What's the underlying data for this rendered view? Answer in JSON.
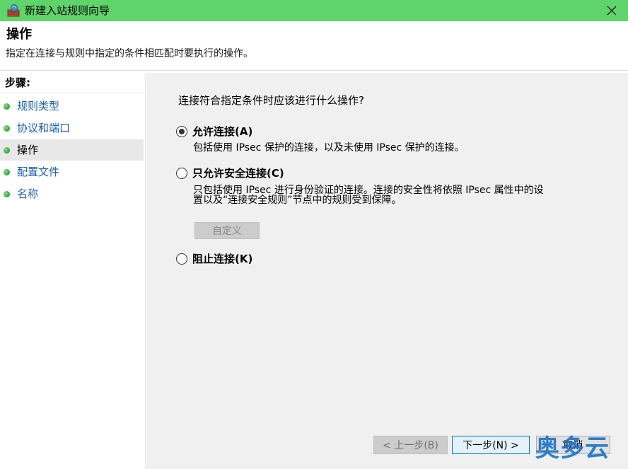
{
  "window": {
    "title": "新建入站规则向导",
    "close_icon": "close-icon",
    "accent": "#5fd46a"
  },
  "header": {
    "title": "操作",
    "subtitle": "指定在连接与规则中指定的条件相匹配时要执行的操作。"
  },
  "steps": {
    "title": "步骤:",
    "items": [
      {
        "label": "规则类型",
        "active": false
      },
      {
        "label": "协议和端口",
        "active": false
      },
      {
        "label": "操作",
        "active": true
      },
      {
        "label": "配置文件",
        "active": false
      },
      {
        "label": "名称",
        "active": false
      }
    ]
  },
  "main": {
    "question": "连接符合指定条件时应该进行什么操作?",
    "options": [
      {
        "label": "允许连接(A)",
        "checked": true,
        "desc": "包括使用 IPsec 保护的连接，以及未使用 IPsec 保护的连接。"
      },
      {
        "label": "只允许安全连接(C)",
        "checked": false,
        "desc_line1": "只包括使用 IPsec 进行身份验证的连接。连接的安全性将依照 IPsec 属性中的设",
        "desc_line2": "置以及“连接安全规则”节点中的规则受到保障。"
      },
      {
        "label": "阻止连接(K)",
        "checked": false
      }
    ],
    "customize_label": "自定义"
  },
  "footer": {
    "back_label": "< 上一步(B)",
    "next_label": "下一步(N) >",
    "cancel_label": "取消"
  },
  "watermark": {
    "text": "奥多云"
  }
}
